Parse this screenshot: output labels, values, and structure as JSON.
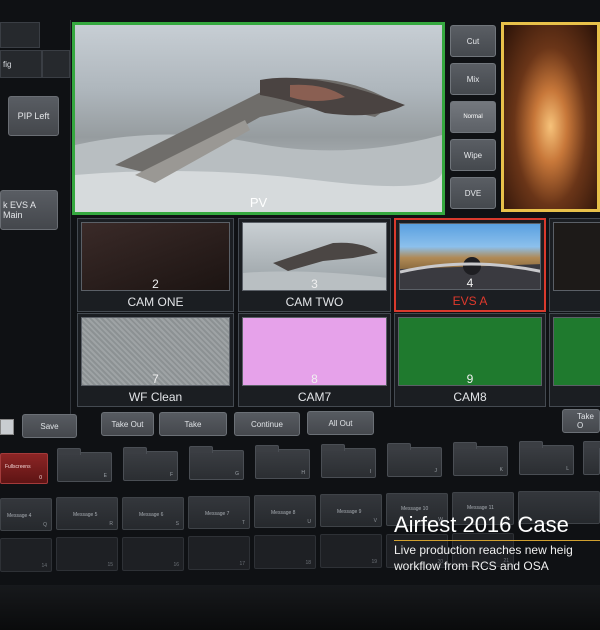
{
  "left_panel": {
    "config_label": "fig",
    "pip_button": "PIP Left",
    "evs_button": "k EVS A Main"
  },
  "monitors": {
    "preview_label": "PV"
  },
  "transitions": [
    {
      "label": "Cut",
      "active": false
    },
    {
      "label": "Mix",
      "active": false
    },
    {
      "label": "Normal",
      "active": true
    },
    {
      "label": "Wipe",
      "active": false
    },
    {
      "label": "DVE",
      "active": false
    }
  ],
  "sources_row1": [
    {
      "number": "2",
      "label": "CAM ONE",
      "active": false
    },
    {
      "number": "3",
      "label": "CAM TWO",
      "active": false
    },
    {
      "number": "4",
      "label": "EVS A",
      "active": true
    },
    {
      "number": "",
      "label": "",
      "active": false
    }
  ],
  "sources_row2": [
    {
      "number": "7",
      "label": "WF Clean"
    },
    {
      "number": "8",
      "label": "CAM7"
    },
    {
      "number": "9",
      "label": "CAM8"
    },
    {
      "number": "",
      "label": ""
    }
  ],
  "actions": {
    "save": "Save",
    "take_out": "Take Out",
    "take": "Take",
    "continue": "Continue",
    "all_out": "All Out",
    "take_right": "Take O"
  },
  "folders": {
    "fullscreens_label": "Fullscreens",
    "fullscreens_key": "0",
    "keys": [
      "E",
      "F",
      "G",
      "H",
      "I",
      "J",
      "K",
      "L"
    ]
  },
  "messages": [
    {
      "label": "Message 4",
      "key": "Q"
    },
    {
      "label": "Message 5",
      "key": "R"
    },
    {
      "label": "Message 6",
      "key": "S"
    },
    {
      "label": "Message 7",
      "key": "T"
    },
    {
      "label": "Message 8",
      "key": "U"
    },
    {
      "label": "Message 9",
      "key": "V"
    },
    {
      "label": "Message 10",
      "key": "W"
    },
    {
      "label": "Message 11",
      "key": "X"
    }
  ],
  "bottom_keys": [
    "14",
    "15",
    "16",
    "17",
    "18",
    "19",
    "20",
    "21"
  ],
  "caption": {
    "title": "Airfest 2016 Case",
    "line1": "Live production reaches new heig",
    "line2": "workflow from RCS and OSA"
  }
}
